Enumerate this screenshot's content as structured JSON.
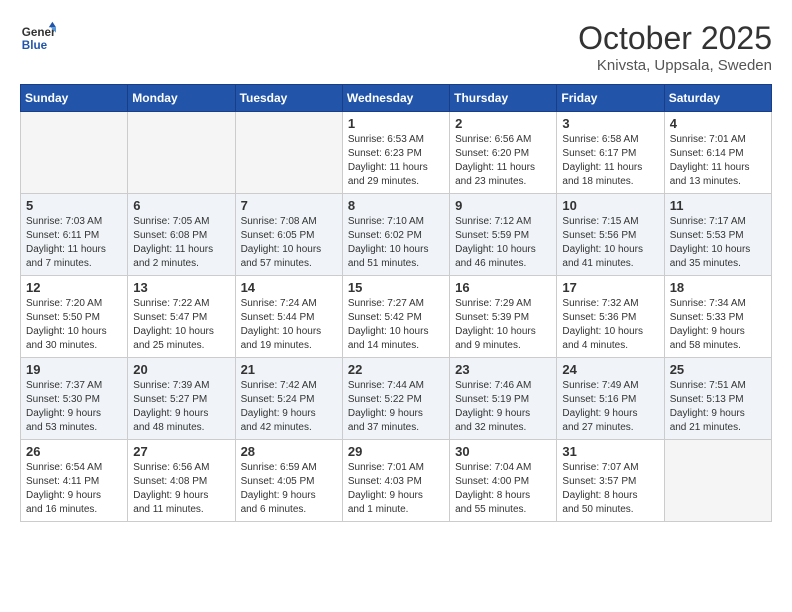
{
  "logo": {
    "line1": "General",
    "line2": "Blue"
  },
  "title": "October 2025",
  "location": "Knivsta, Uppsala, Sweden",
  "weekdays": [
    "Sunday",
    "Monday",
    "Tuesday",
    "Wednesday",
    "Thursday",
    "Friday",
    "Saturday"
  ],
  "weeks": [
    [
      {
        "day": "",
        "info": ""
      },
      {
        "day": "",
        "info": ""
      },
      {
        "day": "",
        "info": ""
      },
      {
        "day": "1",
        "info": "Sunrise: 6:53 AM\nSunset: 6:23 PM\nDaylight: 11 hours\nand 29 minutes."
      },
      {
        "day": "2",
        "info": "Sunrise: 6:56 AM\nSunset: 6:20 PM\nDaylight: 11 hours\nand 23 minutes."
      },
      {
        "day": "3",
        "info": "Sunrise: 6:58 AM\nSunset: 6:17 PM\nDaylight: 11 hours\nand 18 minutes."
      },
      {
        "day": "4",
        "info": "Sunrise: 7:01 AM\nSunset: 6:14 PM\nDaylight: 11 hours\nand 13 minutes."
      }
    ],
    [
      {
        "day": "5",
        "info": "Sunrise: 7:03 AM\nSunset: 6:11 PM\nDaylight: 11 hours\nand 7 minutes."
      },
      {
        "day": "6",
        "info": "Sunrise: 7:05 AM\nSunset: 6:08 PM\nDaylight: 11 hours\nand 2 minutes."
      },
      {
        "day": "7",
        "info": "Sunrise: 7:08 AM\nSunset: 6:05 PM\nDaylight: 10 hours\nand 57 minutes."
      },
      {
        "day": "8",
        "info": "Sunrise: 7:10 AM\nSunset: 6:02 PM\nDaylight: 10 hours\nand 51 minutes."
      },
      {
        "day": "9",
        "info": "Sunrise: 7:12 AM\nSunset: 5:59 PM\nDaylight: 10 hours\nand 46 minutes."
      },
      {
        "day": "10",
        "info": "Sunrise: 7:15 AM\nSunset: 5:56 PM\nDaylight: 10 hours\nand 41 minutes."
      },
      {
        "day": "11",
        "info": "Sunrise: 7:17 AM\nSunset: 5:53 PM\nDaylight: 10 hours\nand 35 minutes."
      }
    ],
    [
      {
        "day": "12",
        "info": "Sunrise: 7:20 AM\nSunset: 5:50 PM\nDaylight: 10 hours\nand 30 minutes."
      },
      {
        "day": "13",
        "info": "Sunrise: 7:22 AM\nSunset: 5:47 PM\nDaylight: 10 hours\nand 25 minutes."
      },
      {
        "day": "14",
        "info": "Sunrise: 7:24 AM\nSunset: 5:44 PM\nDaylight: 10 hours\nand 19 minutes."
      },
      {
        "day": "15",
        "info": "Sunrise: 7:27 AM\nSunset: 5:42 PM\nDaylight: 10 hours\nand 14 minutes."
      },
      {
        "day": "16",
        "info": "Sunrise: 7:29 AM\nSunset: 5:39 PM\nDaylight: 10 hours\nand 9 minutes."
      },
      {
        "day": "17",
        "info": "Sunrise: 7:32 AM\nSunset: 5:36 PM\nDaylight: 10 hours\nand 4 minutes."
      },
      {
        "day": "18",
        "info": "Sunrise: 7:34 AM\nSunset: 5:33 PM\nDaylight: 9 hours\nand 58 minutes."
      }
    ],
    [
      {
        "day": "19",
        "info": "Sunrise: 7:37 AM\nSunset: 5:30 PM\nDaylight: 9 hours\nand 53 minutes."
      },
      {
        "day": "20",
        "info": "Sunrise: 7:39 AM\nSunset: 5:27 PM\nDaylight: 9 hours\nand 48 minutes."
      },
      {
        "day": "21",
        "info": "Sunrise: 7:42 AM\nSunset: 5:24 PM\nDaylight: 9 hours\nand 42 minutes."
      },
      {
        "day": "22",
        "info": "Sunrise: 7:44 AM\nSunset: 5:22 PM\nDaylight: 9 hours\nand 37 minutes."
      },
      {
        "day": "23",
        "info": "Sunrise: 7:46 AM\nSunset: 5:19 PM\nDaylight: 9 hours\nand 32 minutes."
      },
      {
        "day": "24",
        "info": "Sunrise: 7:49 AM\nSunset: 5:16 PM\nDaylight: 9 hours\nand 27 minutes."
      },
      {
        "day": "25",
        "info": "Sunrise: 7:51 AM\nSunset: 5:13 PM\nDaylight: 9 hours\nand 21 minutes."
      }
    ],
    [
      {
        "day": "26",
        "info": "Sunrise: 6:54 AM\nSunset: 4:11 PM\nDaylight: 9 hours\nand 16 minutes."
      },
      {
        "day": "27",
        "info": "Sunrise: 6:56 AM\nSunset: 4:08 PM\nDaylight: 9 hours\nand 11 minutes."
      },
      {
        "day": "28",
        "info": "Sunrise: 6:59 AM\nSunset: 4:05 PM\nDaylight: 9 hours\nand 6 minutes."
      },
      {
        "day": "29",
        "info": "Sunrise: 7:01 AM\nSunset: 4:03 PM\nDaylight: 9 hours\nand 1 minute."
      },
      {
        "day": "30",
        "info": "Sunrise: 7:04 AM\nSunset: 4:00 PM\nDaylight: 8 hours\nand 55 minutes."
      },
      {
        "day": "31",
        "info": "Sunrise: 7:07 AM\nSunset: 3:57 PM\nDaylight: 8 hours\nand 50 minutes."
      },
      {
        "day": "",
        "info": ""
      }
    ]
  ]
}
